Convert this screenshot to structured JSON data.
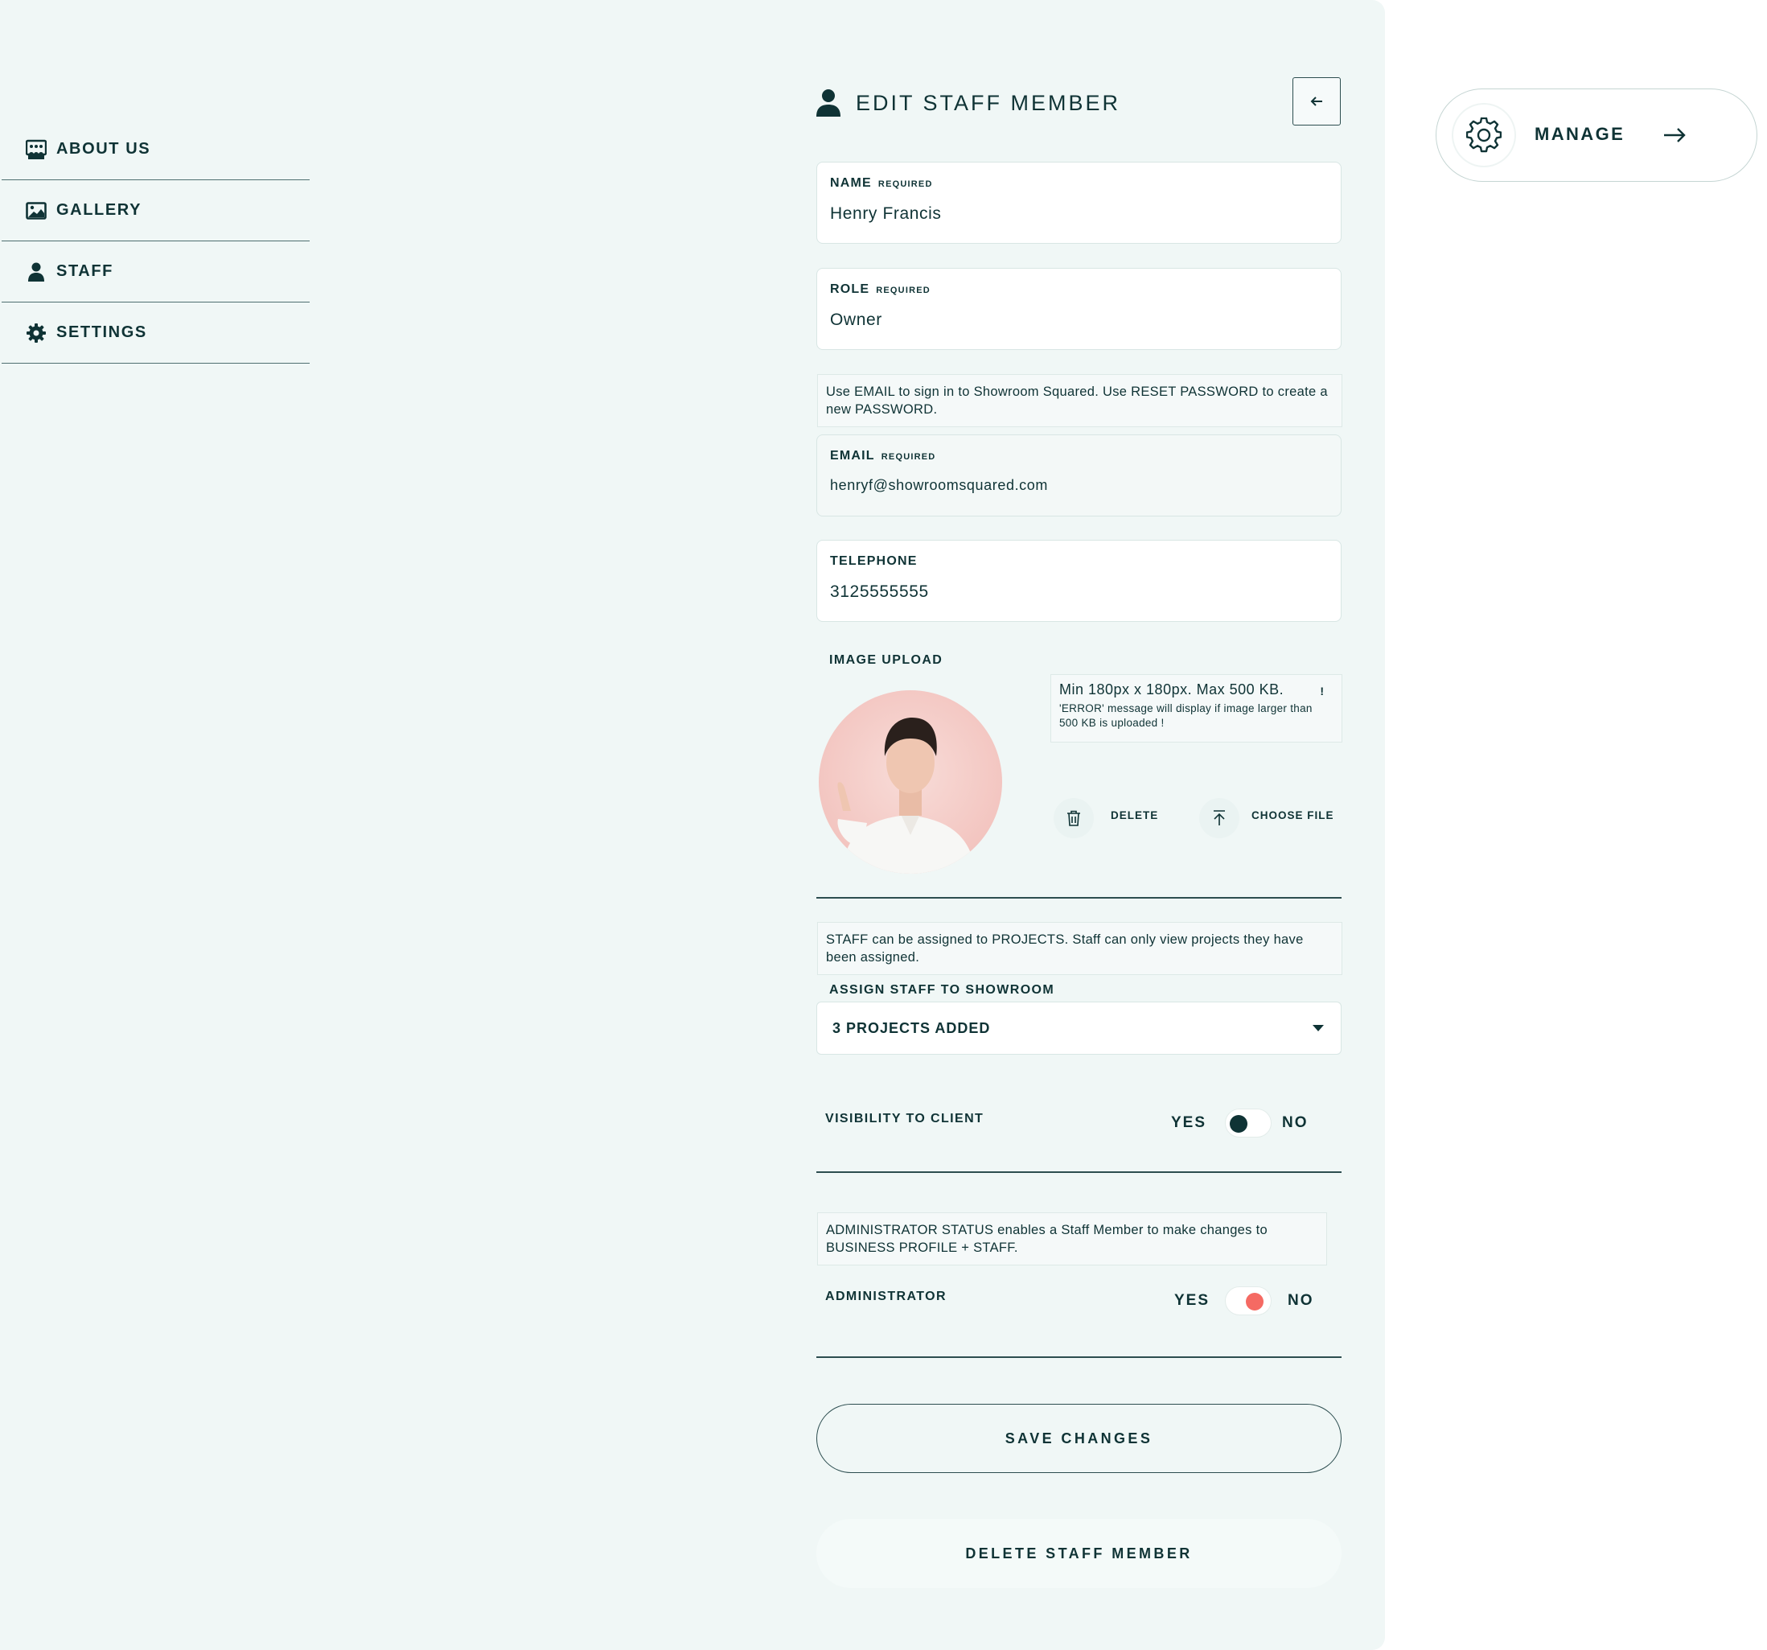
{
  "sidebar": {
    "items": [
      {
        "label": "ABOUT US",
        "icon": "about-us-icon"
      },
      {
        "label": "GALLERY",
        "icon": "gallery-icon"
      },
      {
        "label": "STAFF",
        "icon": "user-icon"
      },
      {
        "label": "SETTINGS",
        "icon": "gear-icon"
      }
    ]
  },
  "header": {
    "title": "EDIT STAFF MEMBER",
    "icon": "user-icon",
    "back_icon": "arrow-left-icon"
  },
  "form": {
    "name": {
      "label": "NAME",
      "required": "REQUIRED",
      "value": "Henry Francis"
    },
    "role": {
      "label": "ROLE",
      "required": "REQUIRED",
      "value": "Owner"
    },
    "email_note": "Use EMAIL to sign in to Showroom Squared. Use RESET PASSWORD to create a new PASSWORD.",
    "email": {
      "label": "EMAIL",
      "required": "REQUIRED",
      "value": "henryf@showroomsquared.com"
    },
    "telephone": {
      "label": "TELEPHONE",
      "value": "3125555555"
    },
    "image": {
      "label": "IMAGE UPLOAD",
      "info_main": "Min 180px x 180px. Max 500 KB.",
      "info_mark": "!",
      "info_sub": "'ERROR' message will display if image larger than 500 KB is uploaded !",
      "delete_label": "DELETE",
      "choose_label": "CHOOSE FILE"
    },
    "staff_note": "STAFF can be assigned to PROJECTS. Staff can only view projects they have been assigned.",
    "assign": {
      "label": "ASSIGN STAFF TO SHOWROOM",
      "selected": "3 PROJECTS ADDED"
    },
    "visibility": {
      "label": "VISIBILITY TO CLIENT",
      "yes": "YES",
      "no": "NO",
      "state": "yes",
      "knob_color": "#0f3335"
    },
    "admin_note": "ADMINISTRATOR STATUS enables a Staff Member to make changes to BUSINESS PROFILE + STAFF.",
    "administrator": {
      "label": "ADMINISTRATOR",
      "yes": "YES",
      "no": "NO",
      "state": "no",
      "knob_color": "#f56a63"
    },
    "save_label": "SAVE CHANGES",
    "delete_label": "DELETE STAFF MEMBER"
  },
  "manage": {
    "label": "MANAGE",
    "icon": "gear-icon",
    "arrow": "arrow-right-icon"
  },
  "colors": {
    "primary": "#0f3335",
    "panel_bg": "#f0f7f6",
    "accent_off": "#f56a63"
  }
}
